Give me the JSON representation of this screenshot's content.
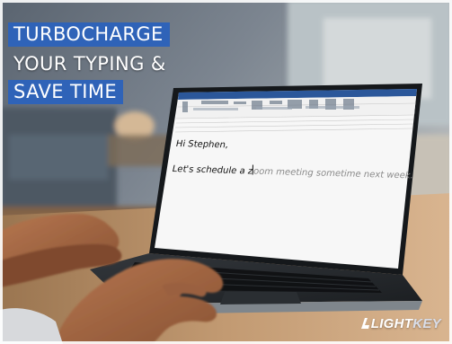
{
  "headline": {
    "line1": "TURBOCHARGE",
    "line2": "YOUR TYPING &",
    "line3": "SAVE TIME"
  },
  "email": {
    "greeting": "Hi Stephen,",
    "typed": "Let's schedule a z",
    "suggestion": "oom meeting sometime next week."
  },
  "logo": {
    "part1": "LIGHT",
    "part2": "KEY"
  },
  "colors": {
    "headline_box": "#2f63b8",
    "ribbon": "#2b579a",
    "suggestion_text": "#8a8a8a"
  }
}
